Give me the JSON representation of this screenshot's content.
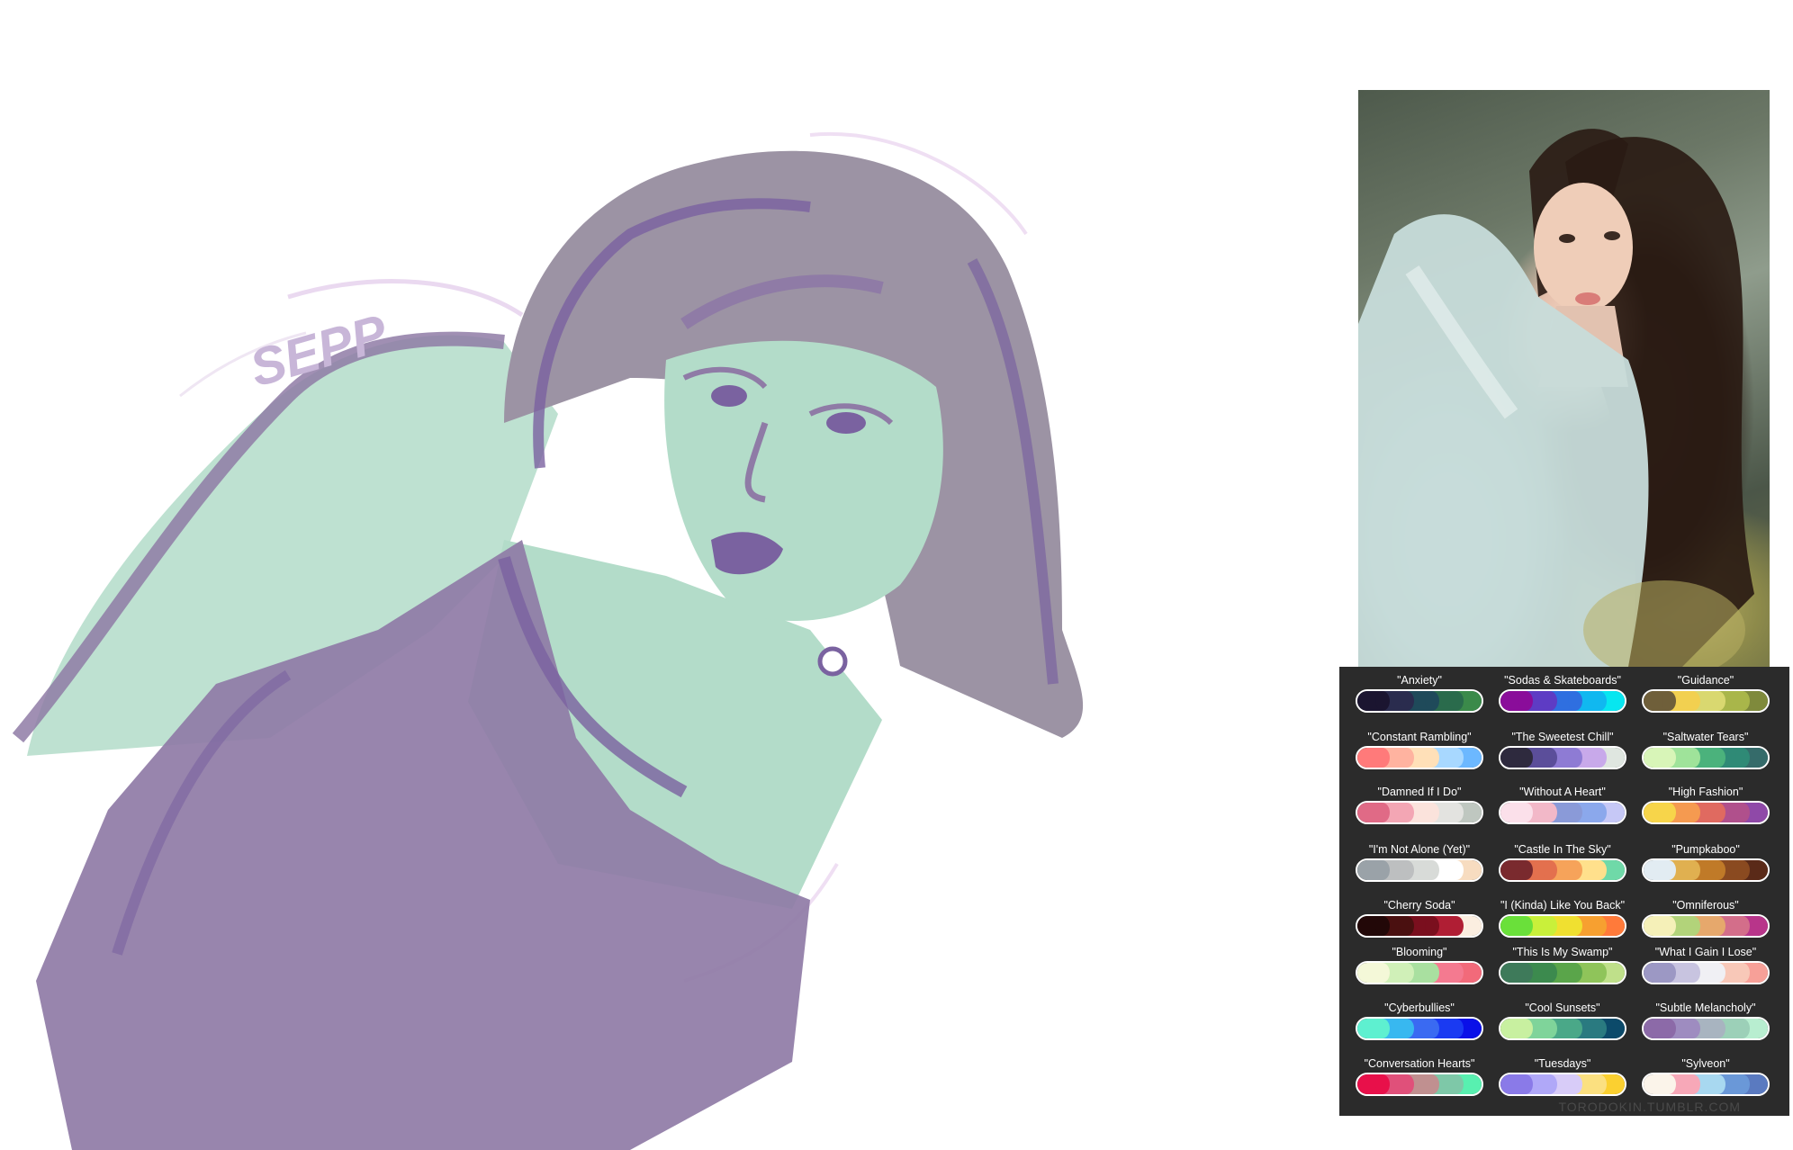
{
  "sketch": {
    "signature": "SEPP",
    "colors": {
      "purple": "#8f7ba6",
      "dark_purple": "#7a62a0",
      "mint": "#b3dcc9",
      "grey_purple": "#9c93a4"
    }
  },
  "reference_photo": {
    "description_colors": [
      "#4e5a4c",
      "#c9dcd9",
      "#2a1c14",
      "#f2d7c6"
    ]
  },
  "palettes": [
    {
      "name": "\"Anxiety\"",
      "colors": [
        "#1b1530",
        "#2a2c4e",
        "#1f4a5a",
        "#2a6b4c",
        "#3b8a4a"
      ]
    },
    {
      "name": "\"Sodas & Skateboards\"",
      "colors": [
        "#8a0d9a",
        "#5e3cc4",
        "#2f6fe0",
        "#10b8f0",
        "#07e6f0"
      ]
    },
    {
      "name": "\"Guidance\"",
      "colors": [
        "#6f5f3a",
        "#f2d050",
        "#d9d870",
        "#a9b64a",
        "#7f8a3c"
      ]
    },
    {
      "name": "\"Constant Rambling\"",
      "colors": [
        "#ff7a7a",
        "#ffb3a0",
        "#ffe0b8",
        "#a8d8ff",
        "#6cb8ff"
      ]
    },
    {
      "name": "\"The Sweetest Chill\"",
      "colors": [
        "#2e2a3e",
        "#5b4e9a",
        "#8e7bd4",
        "#c8a9ea",
        "#dfe6e0"
      ]
    },
    {
      "name": "\"Saltwater Tears\"",
      "colors": [
        "#d8f5b8",
        "#9fe39a",
        "#4bb27c",
        "#2f8a76",
        "#356b6a"
      ]
    },
    {
      "name": "\"Damned If I Do\"",
      "colors": [
        "#e06a86",
        "#f3a6b4",
        "#fbe3dc",
        "#e3e3e0",
        "#bfc7c0"
      ]
    },
    {
      "name": "\"Without A Heart\"",
      "colors": [
        "#fbe0ea",
        "#f2b8c8",
        "#8a9ad8",
        "#8ba8ec",
        "#c6c8f6"
      ]
    },
    {
      "name": "\"High Fashion\"",
      "colors": [
        "#f7d54a",
        "#f59a50",
        "#e06a60",
        "#b0508c",
        "#8f49a8"
      ]
    },
    {
      "name": "\"I'm Not Alone (Yet)\"",
      "colors": [
        "#9aa2a8",
        "#bdbfc0",
        "#d8dbd8",
        "#ffffff",
        "#f7dcc0"
      ]
    },
    {
      "name": "\"Castle In The Sky\"",
      "colors": [
        "#7a2a2e",
        "#e3704e",
        "#f6a35a",
        "#ffe08c",
        "#6fd9a8"
      ]
    },
    {
      "name": "\"Pumpkaboo\"",
      "colors": [
        "#e2ecf2",
        "#e0b050",
        "#c07a28",
        "#8a4a20",
        "#5a2a18"
      ]
    },
    {
      "name": "\"Cherry Soda\"",
      "colors": [
        "#220808",
        "#4a1010",
        "#7a0f1e",
        "#b01e34",
        "#fbeee0"
      ]
    },
    {
      "name": "\"I (Kinda) Like You Back\"",
      "colors": [
        "#6ae03a",
        "#c9f03a",
        "#f0e030",
        "#f7a030",
        "#ff7a3a"
      ]
    },
    {
      "name": "\"Omniferous\"",
      "colors": [
        "#f5f0b8",
        "#b2d37a",
        "#e6a86c",
        "#d36e8a",
        "#b8358a"
      ]
    },
    {
      "name": "\"Blooming\"",
      "colors": [
        "#f4f8d8",
        "#d0f0b8",
        "#a9e0a0",
        "#f47a90",
        "#f26a7a"
      ]
    },
    {
      "name": "\"This Is My Swamp\"",
      "colors": [
        "#3e7a5a",
        "#3c8a4e",
        "#5aa54a",
        "#8fc45a",
        "#bfe08a"
      ]
    },
    {
      "name": "\"What I Gain I Lose\"",
      "colors": [
        "#9c98c4",
        "#c8c4e0",
        "#f0f0f4",
        "#f8c8b8",
        "#f7a098"
      ]
    },
    {
      "name": "\"Cyberbullies\"",
      "colors": [
        "#5ef0d0",
        "#38b8f0",
        "#3a6af2",
        "#1a3af2",
        "#0a10e8"
      ]
    },
    {
      "name": "\"Cool Sunsets\"",
      "colors": [
        "#c8f0a0",
        "#7fd49a",
        "#4aa888",
        "#2a7a80",
        "#0c4a6a"
      ]
    },
    {
      "name": "\"Subtle Melancholy\"",
      "colors": [
        "#8c6aa8",
        "#9e8cc0",
        "#a8b4c0",
        "#9cd0b8",
        "#b8eed0"
      ]
    },
    {
      "name": "\"Conversation Hearts\"",
      "colors": [
        "#e8104a",
        "#e0507a",
        "#c09090",
        "#7ec8a8",
        "#58f0b0"
      ]
    },
    {
      "name": "\"Tuesdays\"",
      "colors": [
        "#8a7ae8",
        "#b0a8f8",
        "#d8ccf8",
        "#fbe080",
        "#fbd030"
      ]
    },
    {
      "name": "\"Sylveon\"",
      "colors": [
        "#fbf4ea",
        "#f7a8b8",
        "#a8d8f0",
        "#6a98d8",
        "#5a7ac0"
      ]
    }
  ],
  "credit": "TORODOKIN.TUMBLR.COM"
}
